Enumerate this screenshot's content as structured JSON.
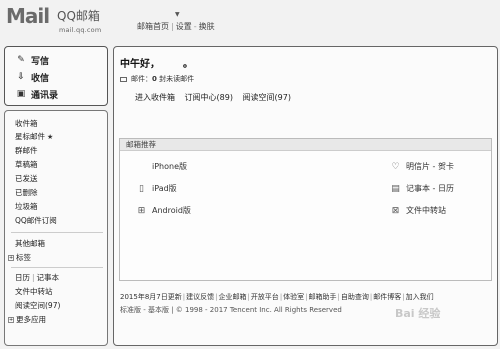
{
  "header": {
    "logo_text": "Mail",
    "brand": "QQ邮箱",
    "domain": "mail.qq.com",
    "user_name": "",
    "user_email": "",
    "links": [
      "邮箱首页",
      "设置",
      "换肤"
    ]
  },
  "sidebar": {
    "top_items": [
      {
        "label": "写信",
        "icon": "pencil-icon"
      },
      {
        "label": "收信",
        "icon": "download-icon"
      },
      {
        "label": "通讯录",
        "icon": "contacts-icon"
      }
    ],
    "folders": [
      "收件箱",
      "星标邮件",
      "群邮件",
      "草稿箱",
      "已发送",
      "已删除",
      "垃圾箱",
      "QQ邮件订阅"
    ],
    "folders_star": "★",
    "other": "其他邮箱",
    "tags": "标签",
    "calendar": "日历",
    "notes": "记事本",
    "transfer": "文件中转站",
    "reading": "阅读空间(97)",
    "more_apps": "更多应用"
  },
  "main": {
    "greeting": "中午好，",
    "greeting_dot": "。",
    "mail_prefix": "邮件：",
    "mail_count": "0",
    "mail_suffix": "封未读邮件",
    "quick_links": [
      "进入收件箱",
      "订阅中心(89)",
      "阅读空间(97)"
    ],
    "recommend_title": "邮箱推荐",
    "recommend_left": [
      {
        "label": "iPhone版",
        "icon": "apple-icon"
      },
      {
        "label": "iPad版",
        "icon": "tablet-icon"
      },
      {
        "label": "Android版",
        "icon": "android-icon"
      }
    ],
    "recommend_right": [
      {
        "label": "明信片 - 贺卡",
        "icon": "heart-icon"
      },
      {
        "label": "记事本 - 日历",
        "icon": "calendar-icon"
      },
      {
        "label": "文件中转站",
        "icon": "file-transfer-icon"
      }
    ],
    "footer_links": [
      "2015年8月7日更新",
      "建议反馈",
      "企业邮箱",
      "开放平台",
      "体验室",
      "邮箱助手",
      "自助查询",
      "邮件博客",
      "加入我们"
    ],
    "footer_copy": "标准版 - 基本版 | © 1998 - 2017 Tencent Inc. All Rights Reserved"
  },
  "watermark": "Bai 经验"
}
